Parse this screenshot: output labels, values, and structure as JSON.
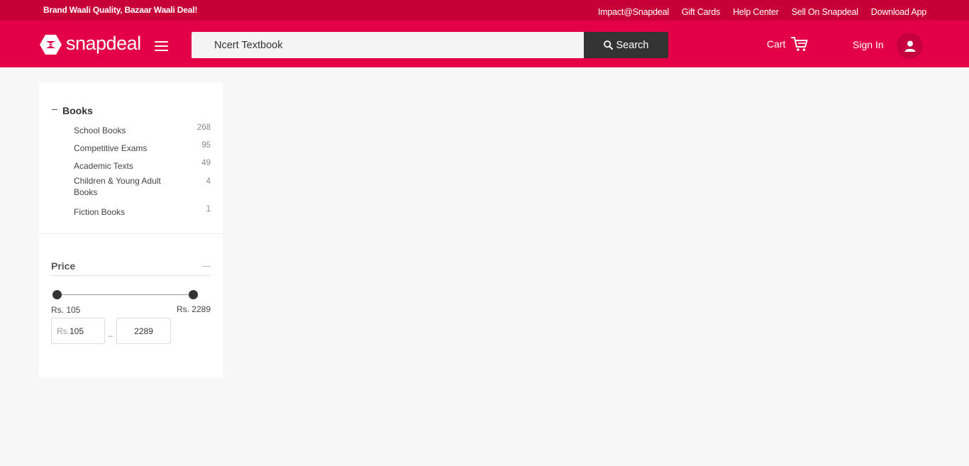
{
  "top_strip": {
    "tagline": "Brand Waali Quality, Bazaar Waali Deal!",
    "links": [
      "Impact@Snapdeal",
      "Gift Cards",
      "Help Center",
      "Sell On Snapdeal",
      "Download App"
    ]
  },
  "header": {
    "logo_text": "snapdeal",
    "search_value": "Ncert Textbook",
    "search_button": "Search",
    "cart_label": "Cart",
    "signin_label": "Sign In"
  },
  "sidebar": {
    "category": {
      "title": "Books",
      "items": [
        {
          "label": "School Books",
          "count": "268"
        },
        {
          "label": "Competitive Exams",
          "count": "95"
        },
        {
          "label": "Academic Texts",
          "count": "49"
        },
        {
          "label": "Children & Young Adult Books",
          "count": "4"
        },
        {
          "label": "Fiction Books",
          "count": "1"
        }
      ]
    },
    "price": {
      "title": "Price",
      "min_label": "Rs. 105",
      "max_label": "Rs. 2289",
      "input_prefix": "Rs.",
      "min_value": "105",
      "max_value": "2289"
    }
  },
  "colors": {
    "brand": "#e40046",
    "top_strip": "#c60036",
    "search_button": "#333333"
  }
}
